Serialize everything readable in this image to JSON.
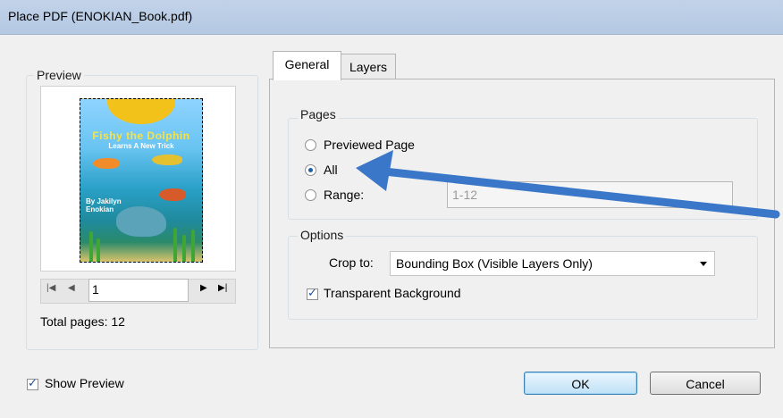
{
  "window": {
    "title": "Place PDF (ENOKIAN_Book.pdf)"
  },
  "preview": {
    "legend": "Preview",
    "thumbnail": {
      "title": "Fishy the Dolphin",
      "subtitle": "Learns A New Trick",
      "byline": "By Jakilyn Enokian"
    },
    "page_value": "1",
    "total_pages": "Total pages: 12"
  },
  "tabs": [
    {
      "label": "General",
      "active": true
    },
    {
      "label": "Layers",
      "active": false
    }
  ],
  "pages_group": {
    "legend": "Pages",
    "options": [
      {
        "label": "Previewed Page",
        "checked": false
      },
      {
        "label": "All",
        "checked": true
      },
      {
        "label": "Range:",
        "checked": false
      }
    ],
    "range_value": "1-12"
  },
  "options_group": {
    "legend": "Options",
    "crop_label": "Crop to:",
    "crop_value": "Bounding Box (Visible Layers Only)",
    "transparent_bg_label": "Transparent Background",
    "transparent_bg_checked": true
  },
  "footer": {
    "show_preview_label": "Show Preview",
    "show_preview_checked": true,
    "ok_label": "OK",
    "cancel_label": "Cancel"
  },
  "annotation": {
    "arrow_color": "#3a77c9"
  }
}
